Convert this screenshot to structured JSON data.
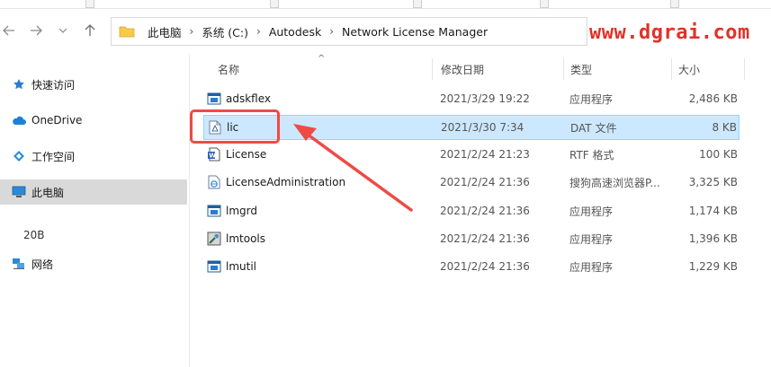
{
  "watermark": "www.dgrai.com",
  "breadcrumb": [
    "此电脑",
    "系统 (C:)",
    "Autodesk",
    "Network License Manager"
  ],
  "sidebar": {
    "items": [
      {
        "label": "快速访问",
        "icon": "star-icon"
      },
      {
        "label": "OneDrive",
        "icon": "cloud-icon"
      },
      {
        "label": "工作空间",
        "icon": "workspace-icon"
      },
      {
        "label": "此电脑",
        "icon": "computer-icon",
        "active": true
      },
      {
        "label": "20B",
        "icon": ""
      },
      {
        "label": "网络",
        "icon": "network-icon"
      }
    ]
  },
  "columns": {
    "name": "名称",
    "date": "修改日期",
    "type": "类型",
    "size": "大小"
  },
  "files": [
    {
      "name": "adskflex",
      "date": "2021/3/29 19:22",
      "type": "应用程序",
      "size": "2,486 KB",
      "icon": "exe-icon"
    },
    {
      "name": "lic",
      "date": "2021/3/30 7:34",
      "type": "DAT 文件",
      "size": "8 KB",
      "icon": "dat-file-icon",
      "selected": true
    },
    {
      "name": "License",
      "date": "2021/2/24 21:23",
      "type": "RTF 格式",
      "size": "100 KB",
      "icon": "rtf-file-icon"
    },
    {
      "name": "LicenseAdministration",
      "date": "2021/2/24 21:36",
      "type": "搜狗高速浏览器P...",
      "size": "3,325 KB",
      "icon": "html-file-icon"
    },
    {
      "name": "lmgrd",
      "date": "2021/2/24 21:36",
      "type": "应用程序",
      "size": "1,174 KB",
      "icon": "exe-icon"
    },
    {
      "name": "lmtools",
      "date": "2021/2/24 21:36",
      "type": "应用程序",
      "size": "1,396 KB",
      "icon": "tools-exe-icon"
    },
    {
      "name": "lmutil",
      "date": "2021/2/24 21:36",
      "type": "应用程序",
      "size": "1,229 KB",
      "icon": "exe-icon"
    }
  ],
  "colors": {
    "accent_annotation": "#ef4b45",
    "selection": "#cce8ff",
    "watermark": "#e0312a"
  }
}
